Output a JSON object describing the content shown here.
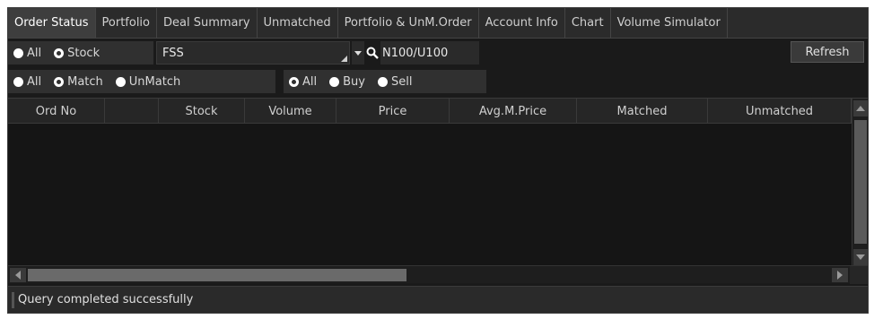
{
  "tabs": [
    {
      "label": "Order Status",
      "active": true
    },
    {
      "label": "Portfolio",
      "active": false
    },
    {
      "label": "Deal Summary",
      "active": false
    },
    {
      "label": "Unmatched",
      "active": false
    },
    {
      "label": "Portfolio & UnM.Order",
      "active": false
    },
    {
      "label": "Account Info",
      "active": false
    },
    {
      "label": "Chart",
      "active": false
    },
    {
      "label": "Volume Simulator",
      "active": false
    }
  ],
  "filters": {
    "scope": {
      "options": [
        {
          "label": "All",
          "selected": false
        },
        {
          "label": "Stock",
          "selected": true
        }
      ]
    },
    "stock_value": "FSS",
    "board_label": "N100/U100",
    "refresh_label": "Refresh",
    "match": {
      "options": [
        {
          "label": "All",
          "selected": false
        },
        {
          "label": "Match",
          "selected": true
        },
        {
          "label": "UnMatch",
          "selected": false
        }
      ]
    },
    "side": {
      "options": [
        {
          "label": "All",
          "selected": true
        },
        {
          "label": "Buy",
          "selected": false
        },
        {
          "label": "Sell",
          "selected": false
        }
      ]
    }
  },
  "grid": {
    "columns": [
      "Ord No",
      "",
      "Stock",
      "Volume",
      "Price",
      "Avg.M.Price",
      "Matched",
      "Unmatched"
    ],
    "rows": []
  },
  "status": {
    "text": "Query completed successfully"
  },
  "icons": {
    "search": "search-icon",
    "dropdown": "chevron-down-icon"
  },
  "colors": {
    "background": "#1a1a1a",
    "tab_active": "#3e3e3e",
    "text": "#d8d8d8"
  }
}
